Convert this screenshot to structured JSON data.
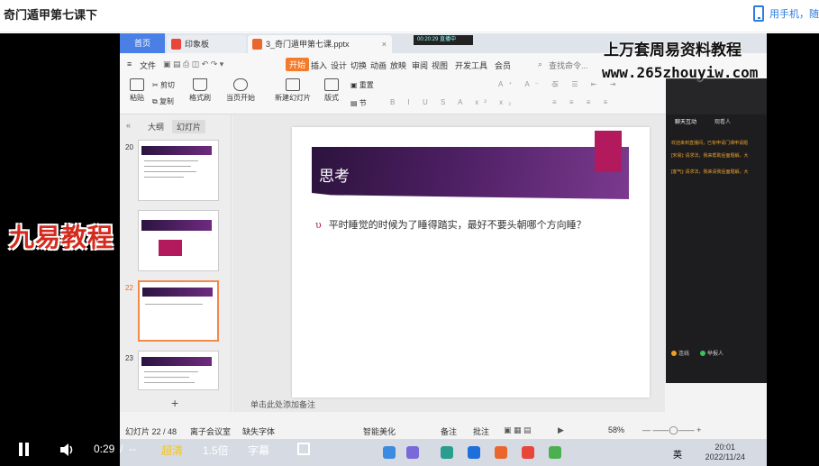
{
  "header": {
    "title": "奇门遁甲第七课下",
    "mobile_link": "用手机，随"
  },
  "wps": {
    "tabs": {
      "home": "首页",
      "tab1": "印象板",
      "tab2": "3_奇门遁甲第七课.pptx",
      "status_chip": "00:20:29  直播中"
    },
    "menu": {
      "file": "文件",
      "active": "开始",
      "items": [
        "插入",
        "设计",
        "切换",
        "动画",
        "放映",
        "审阅",
        "视图",
        "开发工具",
        "会员"
      ],
      "search": "查找命令..."
    },
    "ribbon": {
      "paste": "粘贴",
      "cut": "剪切",
      "copy": "复制",
      "format_painter": "格式刷",
      "from_current": "当页开始",
      "new_slide": "新建幻灯片",
      "layout": "版式",
      "section": "节",
      "reset": "重置"
    },
    "left_pane": {
      "tab_outline": "大纲",
      "tab_slides": "幻灯片",
      "thumbs": [
        {
          "num": "20"
        },
        {
          "num": "21"
        },
        {
          "num": "22"
        },
        {
          "num": "23"
        }
      ]
    },
    "slide": {
      "title": "思考",
      "bullet": "平时睡觉的时候为了睡得踏实，最好不要头朝哪个方向睡？",
      "notes_placeholder": "单击此处添加备注"
    },
    "chat": {
      "tab_chat": "聊天互动",
      "tab_other": "观看人",
      "messages": [
        "欢迎来到直播间，已有申请门课申请题",
        "[宋易]: 请求法，我来帮助后面题解，大",
        "[客气]: 请求法，我来请我后面题解，大"
      ],
      "btn_a": "连线",
      "btn_b": "举报人"
    },
    "statusbar": {
      "slide_pos": "幻灯片 22 / 48",
      "theme": "离子会议室",
      "font": "缺失字体",
      "smart": "智能美化",
      "notes": "备注",
      "comments": "批注",
      "zoom": "58%"
    },
    "taskbar": {
      "time": "20:01",
      "date": "2022/11/24",
      "ime": "英"
    }
  },
  "watermarks": {
    "top": "上万套周易资料教程",
    "url": "www.265zhouyiw.com",
    "left": "九易教程"
  },
  "controls": {
    "time": "0:29",
    "separator": "/",
    "duration": "--",
    "quality": "超清",
    "speed": "1.5倍",
    "subtitle": "字幕"
  },
  "colors": {
    "accent_orange": "#f47b2b",
    "slide_purple": "#4d1f63",
    "slide_magenta": "#b21a5d",
    "quality_yellow": "#f5c518"
  }
}
